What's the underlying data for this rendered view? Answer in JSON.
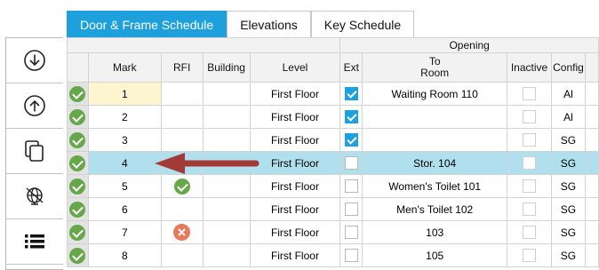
{
  "tabs": [
    {
      "label": "Door & Frame Schedule",
      "active": true
    },
    {
      "label": "Elevations",
      "active": false
    },
    {
      "label": "Key Schedule",
      "active": false
    }
  ],
  "toolbar": [
    {
      "icon": "download-circle-icon"
    },
    {
      "icon": "upload-circle-icon"
    },
    {
      "icon": "copy-icon"
    },
    {
      "icon": "globe-settings-icon"
    },
    {
      "icon": "list-icon"
    }
  ],
  "grid": {
    "group_header": "Opening",
    "columns": {
      "mark": "Mark",
      "rfi": "RFI",
      "building": "Building",
      "level": "Level",
      "ext": "Ext",
      "to_room_line1": "To",
      "to_room_line2": "Room",
      "inactive": "Inactive",
      "config": "Config"
    },
    "rows": [
      {
        "mark": "1",
        "rfi": "",
        "building": "",
        "level": "First Floor",
        "ext": true,
        "to_room": "Waiting Room 110",
        "inactive": false,
        "config": "Al"
      },
      {
        "mark": "2",
        "rfi": "",
        "building": "",
        "level": "First Floor",
        "ext": true,
        "to_room": "",
        "inactive": false,
        "config": "Al"
      },
      {
        "mark": "3",
        "rfi": "",
        "building": "",
        "level": "First Floor",
        "ext": true,
        "to_room": "",
        "inactive": false,
        "config": "SG"
      },
      {
        "mark": "4",
        "rfi": "",
        "building": "",
        "level": "First Floor",
        "ext": false,
        "to_room": "Stor. 104",
        "inactive": false,
        "config": "SG",
        "selected": true
      },
      {
        "mark": "5",
        "rfi": "check-circle-icon",
        "building": "",
        "level": "First Floor",
        "ext": false,
        "to_room": "Women's Toilet 101",
        "inactive": false,
        "config": "SG"
      },
      {
        "mark": "6",
        "rfi": "",
        "building": "",
        "level": "First Floor",
        "ext": false,
        "to_room": "Men's Toilet 102",
        "inactive": false,
        "config": "SG"
      },
      {
        "mark": "7",
        "rfi": "tools-icon",
        "building": "",
        "level": "First Floor",
        "ext": false,
        "to_room": "103",
        "inactive": false,
        "config": "SG"
      },
      {
        "mark": "8",
        "rfi": "",
        "building": "",
        "level": "First Floor",
        "ext": false,
        "to_room": "105",
        "inactive": false,
        "config": "SG"
      }
    ]
  },
  "colors": {
    "tab_active": "#1ea0dc",
    "selected_row": "#b0e0ee",
    "status_ok": "#66a74a",
    "rfi_open": "#e9795a",
    "arrow": "#a23a37"
  }
}
